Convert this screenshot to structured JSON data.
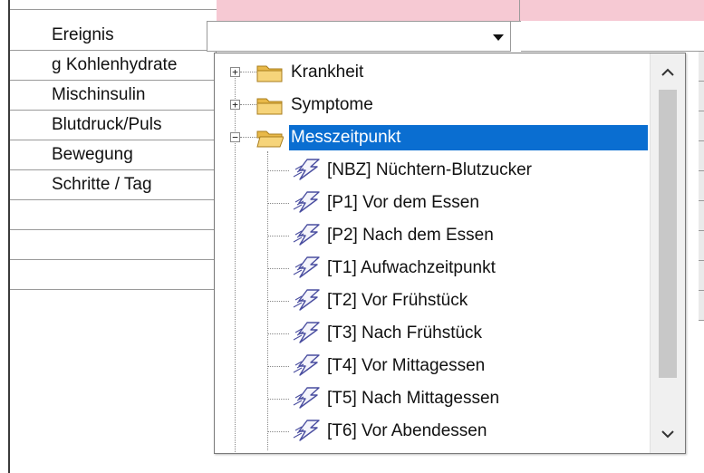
{
  "grid": {
    "rows": [
      {
        "label": "Ereignis"
      },
      {
        "label": "g Kohlenhydrate"
      },
      {
        "label": "Mischinsulin"
      },
      {
        "label": "Blutdruck/Puls"
      },
      {
        "label": "Bewegung"
      },
      {
        "label": "Schritte / Tag"
      },
      {
        "label": ""
      },
      {
        "label": ""
      },
      {
        "label": ""
      }
    ],
    "header_color": "#f6c9d3"
  },
  "dropdown": {
    "value": "",
    "arrow_icon": "chevron-down-icon"
  },
  "tree": {
    "folders": [
      {
        "label": "Krankheit",
        "state": "collapsed",
        "expander": "+"
      },
      {
        "label": "Symptome",
        "state": "collapsed",
        "expander": "+"
      },
      {
        "label": "Messzeitpunkt",
        "state": "expanded",
        "expander": "−",
        "selected": true
      }
    ],
    "items": [
      {
        "label": "[NBZ] Nüchtern-Blutzucker"
      },
      {
        "label": "[P1] Vor dem Essen"
      },
      {
        "label": "[P2] Nach dem Essen"
      },
      {
        "label": "[T1] Aufwachzeitpunkt"
      },
      {
        "label": "[T2] Vor Frühstück"
      },
      {
        "label": "[T3] Nach Frühstück"
      },
      {
        "label": "[T4] Vor Mittagessen"
      },
      {
        "label": "[T5] Nach Mittagessen"
      },
      {
        "label": "[T6] Vor Abendessen"
      }
    ],
    "selection_color": "#0a6ed1"
  },
  "scrollbar": {
    "up_icon": "chevron-up-icon",
    "down_icon": "chevron-down-icon"
  }
}
